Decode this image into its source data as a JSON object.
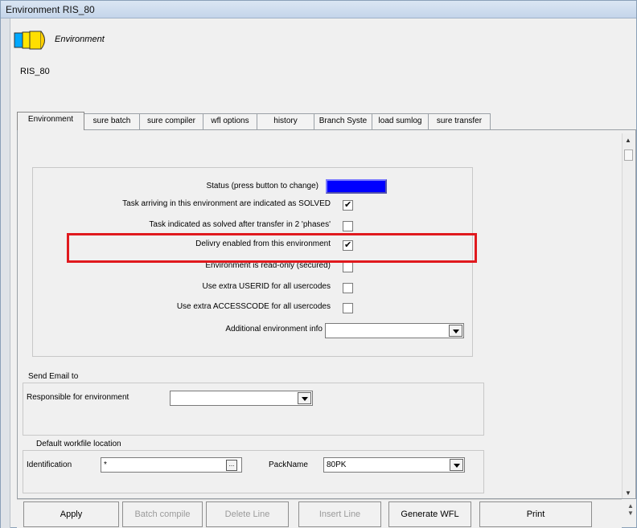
{
  "window": {
    "title": "Environment RIS_80"
  },
  "header": {
    "title": "Environment",
    "name": "RIS_80"
  },
  "tabs": [
    {
      "label": "Environment"
    },
    {
      "label": "sure batch"
    },
    {
      "label": "sure compiler"
    },
    {
      "label": "wfl options"
    },
    {
      "label": "history"
    },
    {
      "label": "Branch Syste"
    },
    {
      "label": "load sumlog"
    },
    {
      "label": "sure transfer"
    }
  ],
  "environment": {
    "status_label": "Status (press button to change)",
    "status_color": "#0000ff",
    "rows": [
      {
        "label": "Task arriving in this environment are indicated as SOLVED",
        "checked": true
      },
      {
        "label": "Task indicated as solved after transfer in 2 'phases'",
        "checked": false
      },
      {
        "label": "Delivry enabled from this environment",
        "checked": true
      },
      {
        "label": "Environment is read-only (secured)",
        "checked": false
      },
      {
        "label": "Use extra USERID for all usercodes",
        "checked": false
      },
      {
        "label": "Use extra ACCESSCODE for all usercodes",
        "checked": false
      }
    ],
    "additional_info_label": "Additional environment info",
    "additional_info_value": ""
  },
  "email": {
    "group_title": "Send Email to",
    "responsible_label": "Responsible for environment",
    "responsible_value": ""
  },
  "workfile": {
    "group_title": "Default workfile location",
    "identification_label": "Identification",
    "identification_value": "*",
    "packname_label": "PackName",
    "packname_value": "80PK"
  },
  "buttons": [
    {
      "label": "Apply",
      "enabled": true
    },
    {
      "label": "Batch compile",
      "enabled": false
    },
    {
      "label": "Delete Line",
      "enabled": false
    },
    {
      "label": "Insert Line",
      "enabled": false
    },
    {
      "label": "Generate WFL",
      "enabled": true
    },
    {
      "label": "Print",
      "enabled": true
    }
  ],
  "highlight_color": "#e0191e"
}
